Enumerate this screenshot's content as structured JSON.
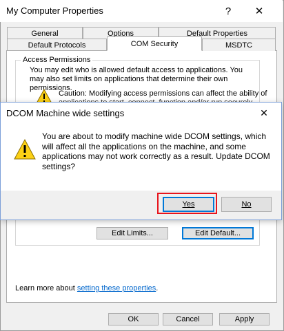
{
  "main_window": {
    "title": "My Computer Properties",
    "help_glyph": "?",
    "close_glyph": "✕"
  },
  "tabs_row1": [
    "General",
    "Options",
    "Default Properties"
  ],
  "tabs_row2": [
    "Default Protocols",
    "COM Security",
    "MSDTC"
  ],
  "active_tab": "COM Security",
  "access_permissions": {
    "legend": "Access Permissions",
    "description": "You may edit who is allowed default access to applications. You may also set limits on applications that determine their own permissions.",
    "caution_line1": "Caution: Modifying access permissions can affect the ability of",
    "caution_line2": "applications to start, connect, function and/or run securely."
  },
  "buttons": {
    "edit_limits": "Edit Limits...",
    "edit_default": "Edit Default..."
  },
  "learn_more": {
    "prefix": "Learn more about ",
    "link": "setting these properties",
    "suffix": "."
  },
  "footer_buttons": {
    "ok": "OK",
    "cancel": "Cancel",
    "apply": "Apply"
  },
  "modal": {
    "title": "DCOM Machine wide settings",
    "close_glyph": "✕",
    "message": "You are about to modify machine wide DCOM settings, which will affect all the applications on the machine, and some applications may not work correctly as a result. Update DCOM settings?",
    "yes_label": "Yes",
    "no_label": "No",
    "icon": "warning-icon"
  },
  "colors": {
    "warning_fill": "#fcd116",
    "highlight": "#e8141c",
    "link": "#0066cc",
    "focus": "#0078d7"
  }
}
